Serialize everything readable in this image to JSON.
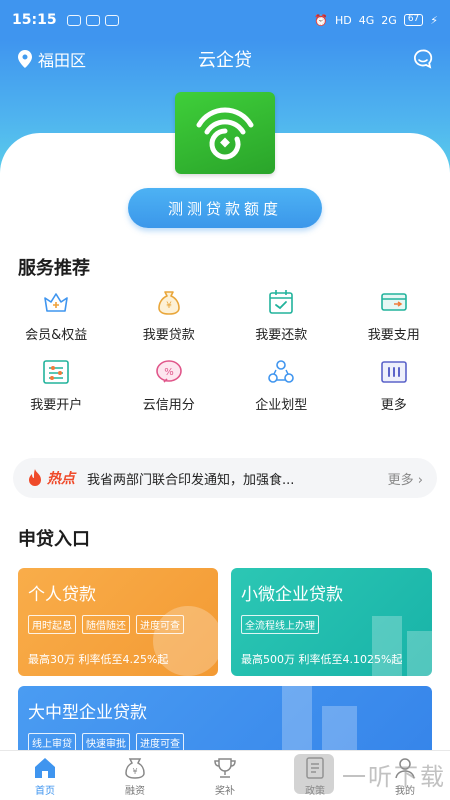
{
  "status_bar": {
    "time": "15:15",
    "network": "HD",
    "signal1": "4G",
    "signal2": "2G",
    "battery": "67"
  },
  "header": {
    "location": "福田区",
    "title": "云企贷"
  },
  "cta": {
    "label": "测测贷款额度"
  },
  "services": {
    "title": "服务推荐",
    "items": [
      {
        "label": "会员&权益",
        "icon": "crown-icon"
      },
      {
        "label": "我要贷款",
        "icon": "money-bag-icon"
      },
      {
        "label": "我要还款",
        "icon": "calendar-icon"
      },
      {
        "label": "我要支用",
        "icon": "card-icon"
      },
      {
        "label": "我要开户",
        "icon": "settings-icon"
      },
      {
        "label": "云信用分",
        "icon": "percent-icon"
      },
      {
        "label": "企业划型",
        "icon": "share-icon"
      },
      {
        "label": "更多",
        "icon": "more-icon"
      }
    ]
  },
  "news": {
    "tag": "热点",
    "text": "我省两部门联合印发通知，加强食...",
    "more": "更多"
  },
  "loan_section": {
    "title": "申贷入口",
    "cards": [
      {
        "title": "个人贷款",
        "tags": [
          "用时起息",
          "随借随还",
          "进度可查"
        ],
        "info": "最高30万 利率低至4.25%起",
        "color": "#f7a13c"
      },
      {
        "title": "小微企业贷款",
        "tags": [
          "全流程线上办理"
        ],
        "info": "最高500万 利率低至4.1025%起",
        "color": "#1fbfae"
      },
      {
        "title": "大中型企业贷款",
        "tags": [
          "线上审贷",
          "快速审批",
          "进度可查"
        ],
        "info": "",
        "color": "#3d8ff0"
      }
    ]
  },
  "tabbar": {
    "items": [
      {
        "label": "首页",
        "icon": "home-icon"
      },
      {
        "label": "融资",
        "icon": "finance-icon"
      },
      {
        "label": "奖补",
        "icon": "trophy-icon"
      },
      {
        "label": "政策",
        "icon": "policy-icon"
      },
      {
        "label": "我的",
        "icon": "user-icon"
      }
    ]
  },
  "watermark": {
    "text": "一听下载"
  },
  "colors": {
    "primary": "#3f95ef",
    "hot": "#ef4a2a"
  }
}
